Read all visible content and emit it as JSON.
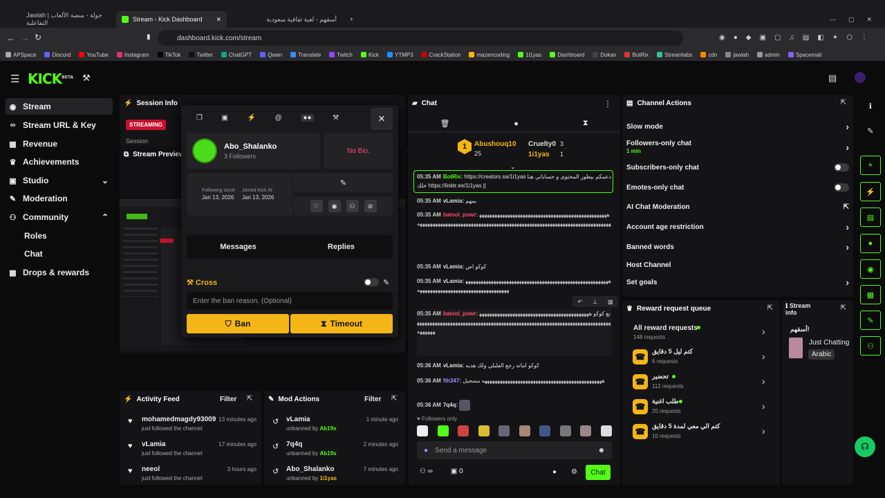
{
  "browser": {
    "tabs": [
      {
        "title": "Jawlah | جولة - منصة الألعاب التفاعلية",
        "active": false
      },
      {
        "title": "Stream - Kick Dashboard",
        "active": true
      },
      {
        "title": "أسقهم - لعبة ثقافية سعودية",
        "active": false
      }
    ],
    "url": "dashboard.kick.com/stream",
    "bookmarks": [
      "APSpace",
      "Discord",
      "YouTube",
      "Instagram",
      "TikTok",
      "Twitter",
      "ChatGPT",
      "Qwen",
      "Translate",
      "Twitch",
      "Kick",
      "YTMP3",
      "CrackStation",
      "mazencoding",
      "1i1yas",
      "Dashboard",
      "Dokan",
      "BotRix",
      "Streamlabs",
      "cdn",
      "jawlah",
      "admin",
      "Spacemail"
    ]
  },
  "header": {
    "logo": "KICK",
    "logo_tag": "BETA"
  },
  "sidebar": {
    "items": [
      {
        "label": "Stream",
        "icon": "broadcast-icon",
        "selected": true
      },
      {
        "label": "Stream URL & Key",
        "icon": "link-icon"
      },
      {
        "label": "Revenue",
        "icon": "revenue-icon"
      },
      {
        "label": "Achievements",
        "icon": "trophy-icon"
      },
      {
        "label": "Studio",
        "icon": "studio-icon"
      },
      {
        "label": "Moderation",
        "icon": "wrench-icon"
      },
      {
        "label": "Community",
        "icon": "community-icon"
      }
    ],
    "community_sub": [
      "Roles",
      "Chat"
    ],
    "drops": "Drops & rewards"
  },
  "session": {
    "title": "Session Info",
    "status": "STREAMING",
    "session_label": "Session"
  },
  "preview": {
    "title": "Stream Preview"
  },
  "user_card": {
    "username": "Abo_Shalanko",
    "followers": "3 Followers",
    "bio": "No Bio.",
    "following_since_label": "Following since",
    "following_since": "Jan 13, 2026",
    "joined_label": "Joined Kick At",
    "joined": "Jan 13, 2026",
    "tab_messages": "Messages",
    "tab_replies": "Replies",
    "ban_user_label": "Cross",
    "ban_placeholder": "Enter the ban reason. (Optional)",
    "ban_button": "Ban",
    "timeout_button": "Timeout"
  },
  "chat": {
    "title": "Chat",
    "leader1": {
      "name": "Abushouq10",
      "count": "25"
    },
    "leader2": {
      "name": "Cruelty0",
      "count": "3"
    },
    "leader3": {
      "name": "1i1yas",
      "count": "1"
    },
    "messages": [
      {
        "time": "05:35 AM",
        "user": "BotRix:",
        "color": "#53fc18",
        "text": "https://creators.sa/1i1yas دعمكم بيطور المحتوى و حساباتي هنا خلك https://linktr.ee/1i1yas ||"
      },
      {
        "time": "05:35 AM",
        "user": "vLamia:",
        "color": "#e8e8e8",
        "text": "يمهم"
      },
      {
        "time": "05:35 AM",
        "user": "batool_powr:",
        "color": "#ff4d6d",
        "text": "ههههههههههههههههههههههههههههههههههههههههههههههههههههههههههههههههههههههههههههههههههههههههههههههههههههههههههههههههههههههههههههههه"
      },
      {
        "time": "05:35 AM",
        "user": "vLamia:",
        "color": "#e8e8e8",
        "text": "كوكو اص"
      },
      {
        "time": "05:35 AM",
        "user": "vLamia:",
        "color": "#e8e8e8",
        "text": "ههههههههههههههههههههههههههههههههههههههههههههههههههههههههههههههههههههههههههههههههههههههههههههه"
      },
      {
        "time": "05:35 AM",
        "user": "batool_powr:",
        "color": "#ff4d6d",
        "text": "نع كوكو ههههههههههههههههههههههههههههههههههههههههههههههههههههههههههههههههههههههههههههههههههههههههههههههههههههههههههههههههههههههههههههههه"
      },
      {
        "time": "05:36 AM",
        "user": "vLamia:",
        "color": "#e8e8e8",
        "text": "كوكو اماته رجع الفلبلي ولك هديه"
      },
      {
        "time": "05:36 AM",
        "user": "fth347:",
        "color": "#a78bfa",
        "text": "هههههههههههههههههههههههههههههههههههههههههههههههه مسجيل"
      },
      {
        "time": "05:36 AM",
        "user": "7q4q:",
        "color": "#e8e8e8",
        "text": ""
      }
    ],
    "followers_only": "Followers only",
    "input_placeholder": "Send a message",
    "footer_count": "0",
    "send_button": "Chat"
  },
  "channel_actions": {
    "title": "Channel Actions",
    "items": [
      {
        "label": "Slow mode",
        "sub": "",
        "control": "chevron"
      },
      {
        "label": "Followers-only chat",
        "sub": "1 min",
        "control": "chevron"
      },
      {
        "label": "Subscribers-only chat",
        "sub": "",
        "control": "toggle"
      },
      {
        "label": "Emotes-only chat",
        "sub": "",
        "control": "toggle"
      },
      {
        "label": "AI Chat Moderation",
        "sub": "",
        "control": "external"
      },
      {
        "label": "Account age restriction",
        "sub": "",
        "control": "chevron"
      },
      {
        "label": "Banned words",
        "sub": "",
        "control": "chevron"
      },
      {
        "label": "Host Channel",
        "sub": "",
        "control": "none"
      },
      {
        "label": "Set goals",
        "sub": "",
        "control": "chevron"
      }
    ]
  },
  "rewards": {
    "title": "Reward request queue",
    "all_label": "All reward requests",
    "all_count": "148 requests",
    "items": [
      {
        "name": "كتم ليل 5 دقايق",
        "count": "6 requests"
      },
      {
        "name": "تحضير",
        "count": "112 requests"
      },
      {
        "name": "طلب اغنية",
        "count": "20 requests"
      },
      {
        "name": "كتم الي معي لمدة 5 دقايق",
        "count": "10 requests"
      }
    ]
  },
  "stream_info": {
    "title": "Stream info",
    "stream_title": "أسقهم!",
    "category": "Just Chatting",
    "tag": "Arabic"
  },
  "activity": {
    "title": "Activity Feed",
    "filter": "Filter",
    "items": [
      {
        "name": "mohamedmagdy93009",
        "sub": "just followed the channel",
        "time": "13 minutes ago"
      },
      {
        "name": "vLamia",
        "sub": "just followed the channel",
        "time": "17 minutes ago"
      },
      {
        "name": "neeol",
        "sub": "just followed the channel",
        "time": "3 hours ago"
      }
    ]
  },
  "mod_actions": {
    "title": "Mod Actions",
    "filter": "Filter",
    "items": [
      {
        "name": "vLamia",
        "sub": "unbanned by",
        "by": "Ab19s",
        "time": "1 minute ago"
      },
      {
        "name": "7q4q",
        "sub": "unbanned by",
        "by": "Ab19s",
        "time": "2 minutes ago"
      },
      {
        "name": "Abo_Shalanko",
        "sub": "unbanned by",
        "by": "1i1yas",
        "time": "7 minutes ago"
      }
    ]
  }
}
